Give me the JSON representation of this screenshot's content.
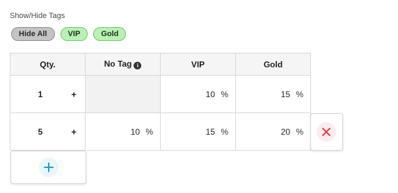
{
  "tags_section": {
    "label": "Show/Hide Tags",
    "buttons": [
      {
        "label": "Hide All",
        "style": "grey"
      },
      {
        "label": "VIP",
        "style": "green"
      },
      {
        "label": "Gold",
        "style": "green"
      }
    ]
  },
  "table": {
    "headers": {
      "qty": "Qty.",
      "no_tag": "No Tag",
      "no_tag_icon": "info-icon",
      "vip": "VIP",
      "gold": "Gold"
    },
    "rows": [
      {
        "qty": "1",
        "qty_plus": "+",
        "no_tag": null,
        "vip": "10",
        "gold": "15",
        "percent": "%"
      },
      {
        "qty": "5",
        "qty_plus": "+",
        "no_tag": "10",
        "vip": "15",
        "gold": "20",
        "percent": "%"
      }
    ]
  },
  "actions": {
    "delete_icon": "close-icon",
    "add_icon": "plus-icon"
  },
  "colors": {
    "tag_green_bg": "#b9f0b4",
    "tag_grey_bg": "#c4c4c4",
    "delete_red": "#e8343f",
    "add_blue": "#1b9fd0"
  }
}
